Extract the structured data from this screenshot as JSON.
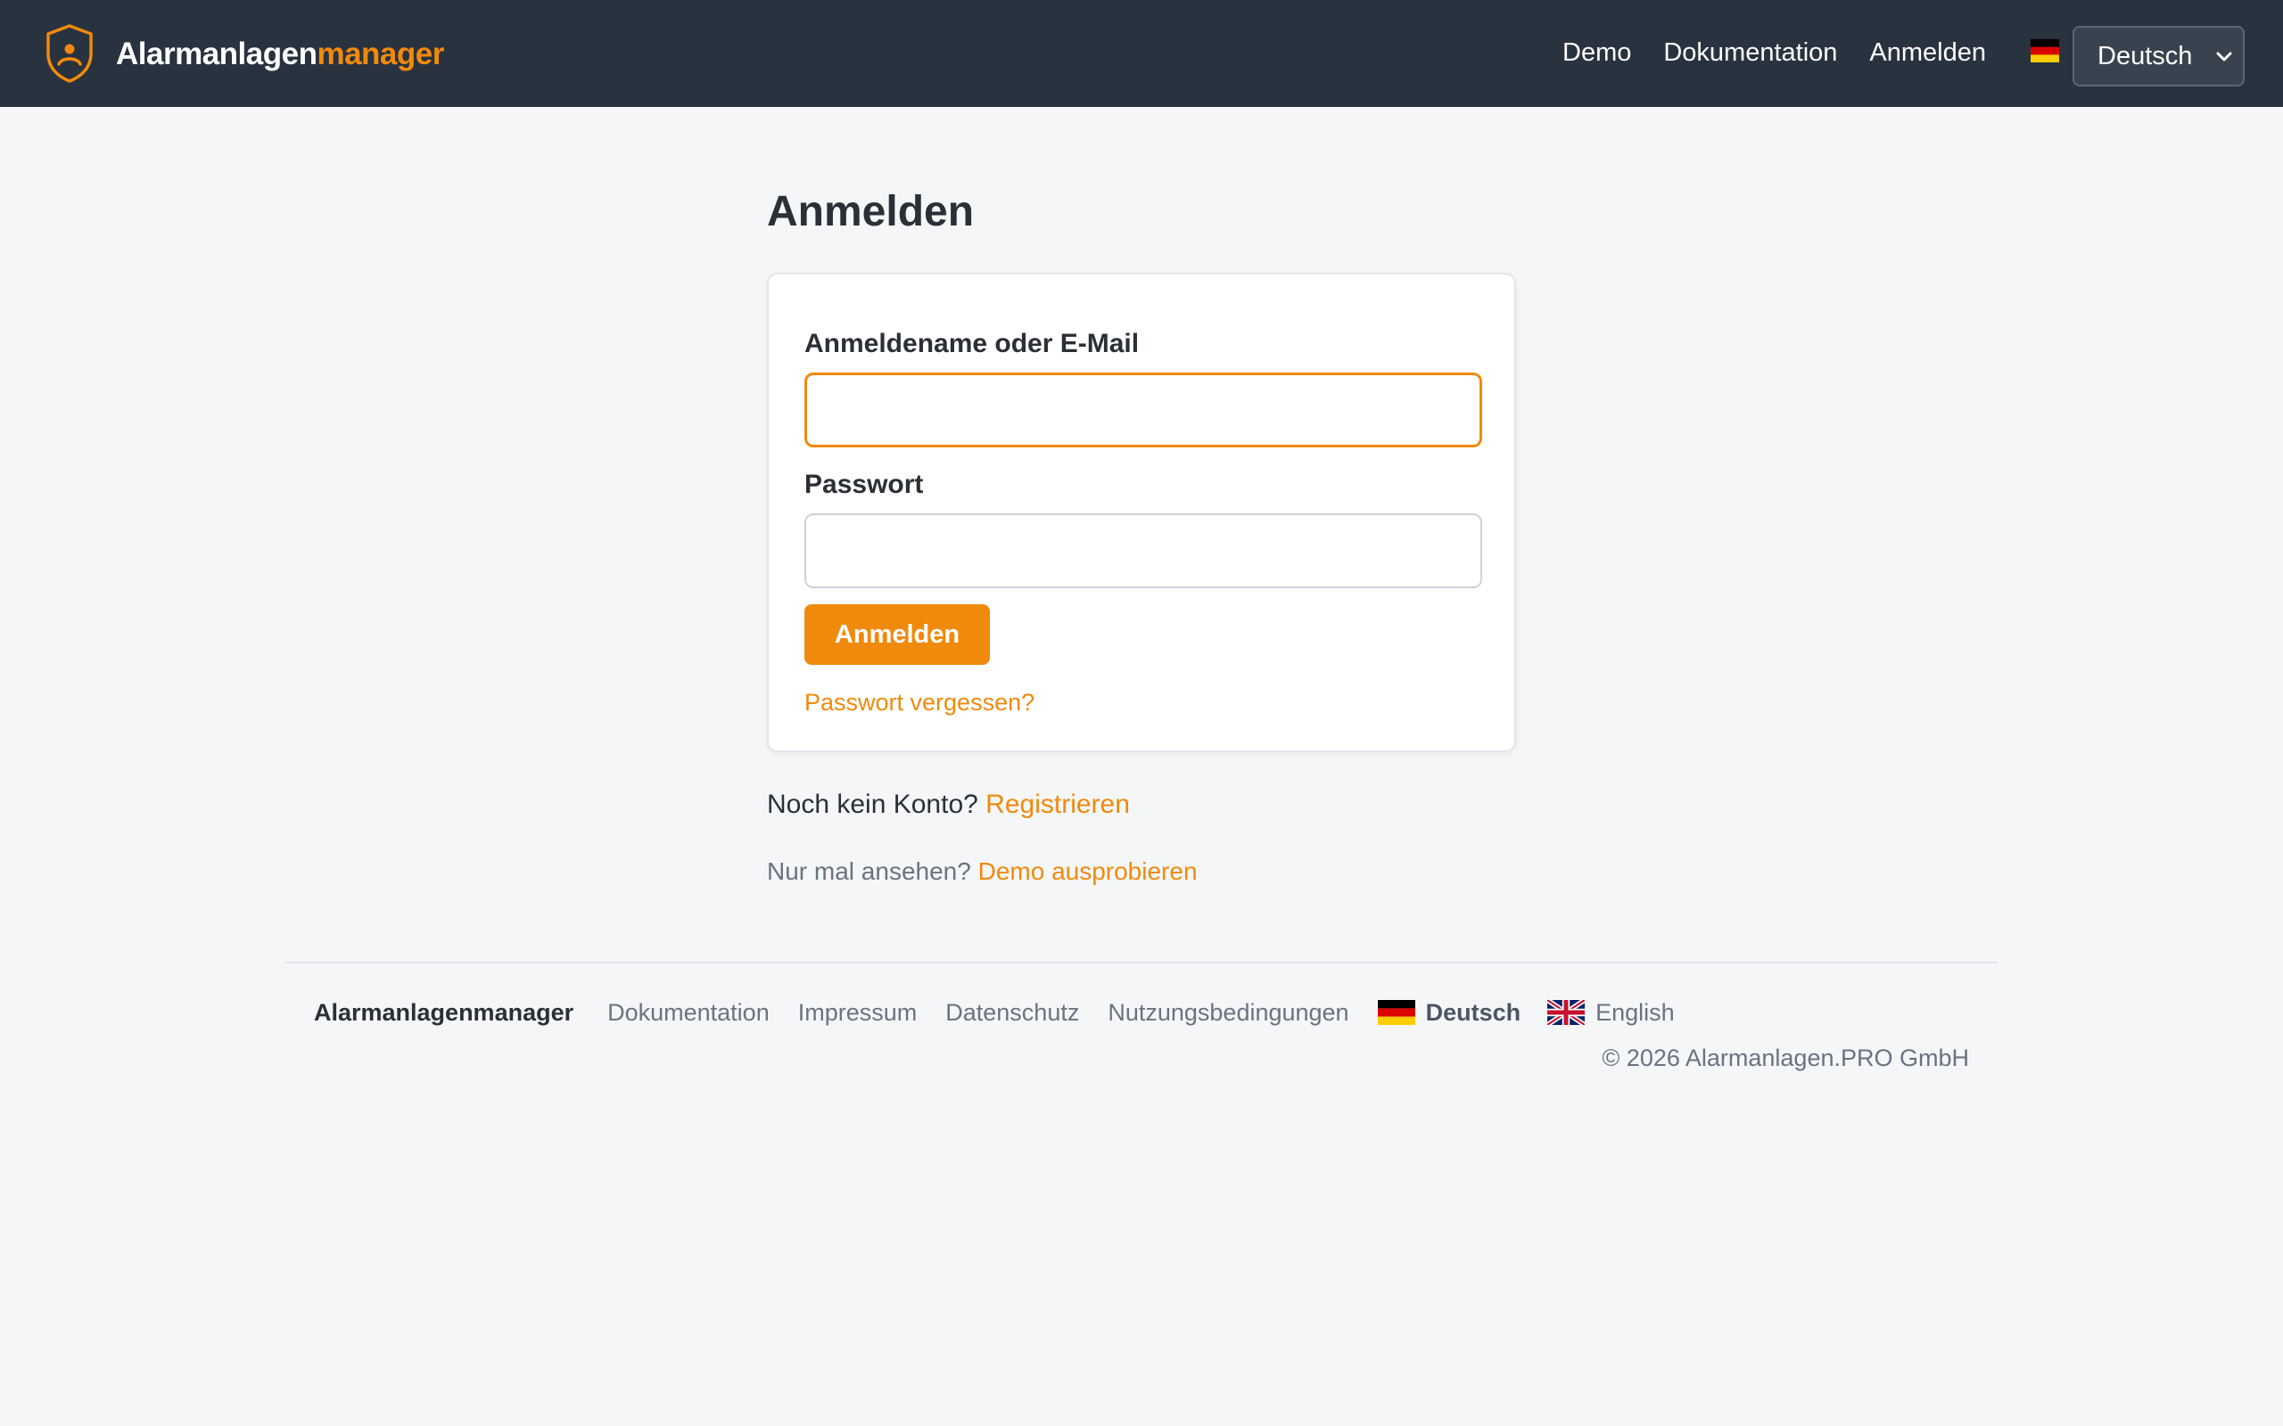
{
  "header": {
    "brand_part1": "Alarmanlagen",
    "brand_part2": "manager",
    "nav": {
      "demo": "Demo",
      "docs": "Dokumentation",
      "login": "Anmelden"
    },
    "language_select_value": "Deutsch",
    "language_flag_icon": "germany-flag-icon"
  },
  "main": {
    "title": "Anmelden",
    "form": {
      "username_label": "Anmeldename oder E-Mail",
      "username_value": "",
      "password_label": "Passwort",
      "password_value": "",
      "submit_label": "Anmelden",
      "forgot_link": "Passwort vergessen?"
    },
    "register": {
      "prompt": "Noch kein Konto?",
      "link": "Registrieren"
    },
    "demo": {
      "prompt": "Nur mal ansehen?",
      "link": "Demo ausprobieren"
    }
  },
  "footer": {
    "brand": "Alarmanlagenmanager",
    "links": {
      "docs": "Dokumentation",
      "imprint": "Impressum",
      "privacy": "Datenschutz",
      "terms": "Nutzungsbedingungen"
    },
    "languages": {
      "german": "Deutsch",
      "english": "English"
    },
    "copyright": "© 2026 Alarmanlagen.PRO GmbH"
  },
  "colors": {
    "navbar_bg": "#29323f",
    "accent": "#f08a0c",
    "page_bg": "#f5f6f8"
  }
}
